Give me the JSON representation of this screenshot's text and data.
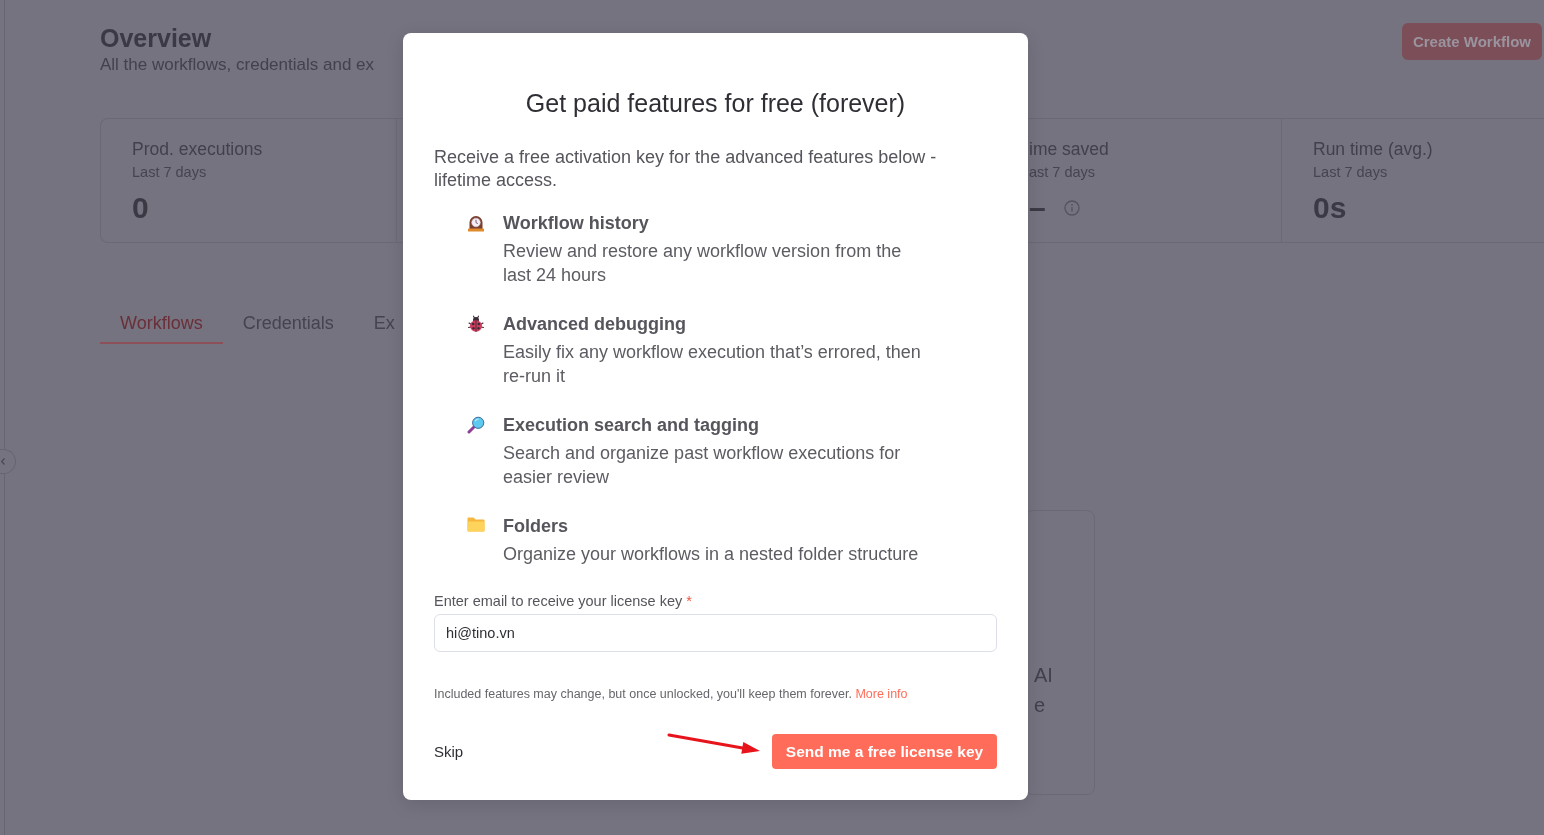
{
  "header": {
    "title": "Overview",
    "subtitle": "All the workflows, credentials and ex",
    "create_button": "Create Workflow"
  },
  "stats": [
    {
      "label": "Prod. executions",
      "period": "Last 7 days",
      "value": "0",
      "info": false
    },
    {
      "label": "ime saved",
      "period": "ast 7 days",
      "value": "–",
      "info": true
    },
    {
      "label": "Run time (avg.)",
      "period": "Last 7 days",
      "value": "0s",
      "info": false
    }
  ],
  "tabs": [
    {
      "label": "Workflows",
      "selected": true
    },
    {
      "label": "Credentials",
      "selected": false
    },
    {
      "label": "Ex",
      "selected": false
    }
  ],
  "card": {
    "lines": [
      "AI",
      "e"
    ]
  },
  "modal": {
    "title": "Get paid features for free (forever)",
    "description": "Receive a free activation key for the advanced features below - lifetime access.",
    "features": [
      {
        "title": "Workflow history",
        "description": "Review and restore any workflow version from the last 24 hours"
      },
      {
        "title": "Advanced debugging",
        "description": "Easily fix any workflow execution that’s errored, then re-run it"
      },
      {
        "title": "Execution search and tagging",
        "description": "Search and organize past workflow executions for easier review"
      },
      {
        "title": "Folders",
        "description": "Organize your workflows in a nested folder structure"
      }
    ],
    "email": {
      "label": "Enter email to receive your license key",
      "required_mark": "*",
      "value": "hi@tino.vn"
    },
    "footnote": {
      "text": "Included features may change, but once unlocked, you'll keep them forever.",
      "link": "More info"
    },
    "skip_button": "Skip",
    "submit_button": "Send me a free license key"
  }
}
